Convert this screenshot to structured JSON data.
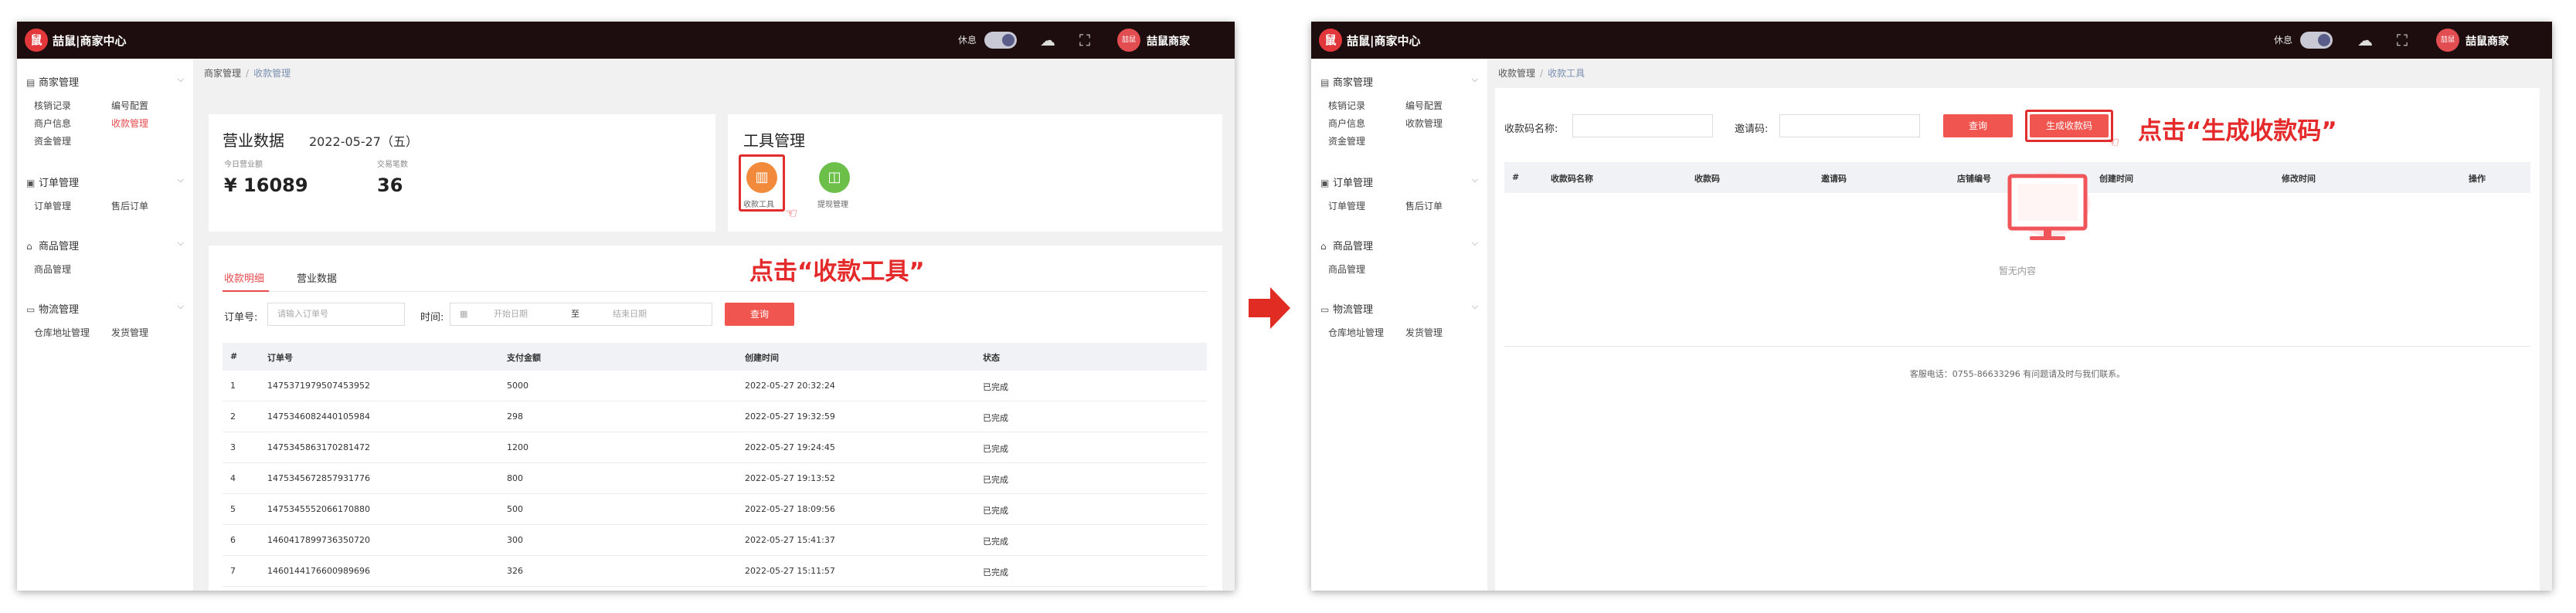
{
  "app": {
    "brand": "喆鼠|商家中心",
    "logo_glyph": "鼠",
    "rest_label": "休息",
    "shop_name": "喆鼠商家",
    "avatar_text": "喆鼠"
  },
  "colors": {
    "accent": "#e84a4d",
    "topbar": "#1d0d0f",
    "button": "#f0554f",
    "callout": "#e42a2a",
    "arrow": "#e02c22"
  },
  "sidebar": {
    "groups": [
      {
        "title": "商家管理",
        "icon": "store-icon",
        "items": [
          "核销记录",
          "编号配置",
          "商户信息",
          "收款管理",
          "资金管理"
        ],
        "active": "收款管理"
      },
      {
        "title": "订单管理",
        "icon": "order-icon",
        "items": [
          "订单管理",
          "售后订单"
        ]
      },
      {
        "title": "商品管理",
        "icon": "bag-icon",
        "items": [
          "商品管理"
        ]
      },
      {
        "title": "物流管理",
        "icon": "truck-icon",
        "items": [
          "仓库地址管理",
          "发货管理"
        ]
      }
    ]
  },
  "screen1": {
    "breadcrumb": [
      "商家管理",
      "收款管理"
    ],
    "sales": {
      "title": "营业数据",
      "date": "2022-05-27（五）",
      "today_label": "今日营业额",
      "today_value": "¥ 16089",
      "count_label": "交易笔数",
      "count_value": "36"
    },
    "tools": {
      "title": "工具管理",
      "items": [
        {
          "label": "收款工具",
          "icon": "receipt-icon",
          "color": "#f28a3c"
        },
        {
          "label": "提现管理",
          "icon": "cup-icon",
          "color": "#6cc04a"
        }
      ],
      "callout": "点击“收款工具”"
    },
    "tabs": [
      "收款明细",
      "营业数据"
    ],
    "filter": {
      "order_label": "订单号:",
      "order_placeholder": "请输入订单号",
      "time_label": "时间:",
      "start_placeholder": "开始日期",
      "range_sep": "至",
      "end_placeholder": "结束日期",
      "query_button": "查询"
    },
    "table": {
      "headers": [
        "#",
        "订单号",
        "支付金额",
        "创建时间",
        "状态"
      ],
      "rows": [
        [
          "1",
          "1475371979507453952",
          "5000",
          "2022-05-27 20:32:24",
          "已完成"
        ],
        [
          "2",
          "1475346082440105984",
          "298",
          "2022-05-27 19:32:59",
          "已完成"
        ],
        [
          "3",
          "1475345863170281472",
          "1200",
          "2022-05-27 19:24:45",
          "已完成"
        ],
        [
          "4",
          "1475345672857931776",
          "800",
          "2022-05-27 19:13:52",
          "已完成"
        ],
        [
          "5",
          "1475345552066170880",
          "500",
          "2022-05-27 18:09:56",
          "已完成"
        ],
        [
          "6",
          "1460417899736350720",
          "300",
          "2022-05-27 15:41:37",
          "已完成"
        ],
        [
          "7",
          "1460144176600989696",
          "326",
          "2022-05-27 15:11:57",
          "已完成"
        ]
      ]
    }
  },
  "screen2": {
    "breadcrumb": [
      "收款管理",
      "收款工具"
    ],
    "filter": {
      "name_label": "收款码名称:",
      "invite_label": "邀请码:",
      "query_button": "查询",
      "generate_button": "生成收款码"
    },
    "callout": "点击“生成收款码”",
    "table_headers": [
      "#",
      "收款码名称",
      "收款码",
      "邀请码",
      "店铺编号",
      "创建时间",
      "修改时间",
      "操作"
    ],
    "empty_text": "暂无内容",
    "footer": "客服电话：0755-86633296 有问题请及时与我们联系。"
  }
}
